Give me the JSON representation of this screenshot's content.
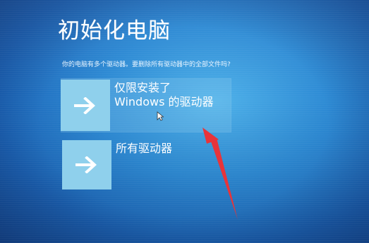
{
  "title": "初始化电脑",
  "question": "你的电脑有多个驱动器。要删除所有驱动器中的全部文件吗?",
  "options": [
    {
      "label_line1": "仅限安装了",
      "label_line2": "Windows 的驱动器",
      "icon": "arrow-right-icon"
    },
    {
      "label_line1": "所有驱动器",
      "icon": "arrow-right-icon"
    }
  ],
  "colors": {
    "background": "#2d8ad4",
    "tile": "#8fd0ec",
    "highlight": "#a0d7f0",
    "annotation_arrow": "#e8343a",
    "text": "#ffffff"
  }
}
